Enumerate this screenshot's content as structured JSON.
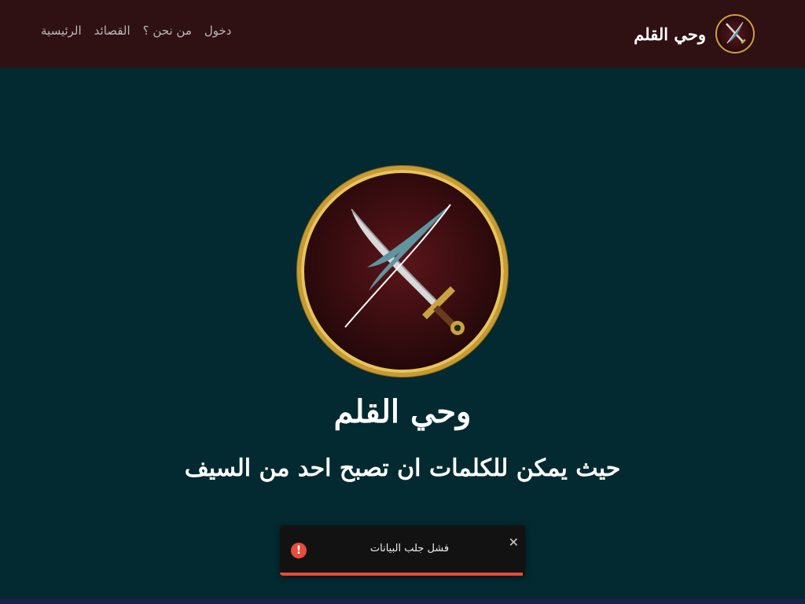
{
  "header": {
    "brand_title": "وحي القلم",
    "nav": [
      {
        "label": "الرئيسية"
      },
      {
        "label": "القصائد"
      },
      {
        "label": "من نحن ؟"
      },
      {
        "label": "دخول"
      }
    ]
  },
  "hero": {
    "title": "وحي القلم",
    "subtitle": "حيث يمكن للكلمات ان تصبح احد من السيف"
  },
  "toast": {
    "message": "فشل جلب البيانات",
    "icon": "!",
    "close_label": "✕",
    "progress": 0.99
  },
  "colors": {
    "header_bg": "#2f1013",
    "page_bg": "#022a30",
    "accent_gold": "#c9a340",
    "toast_error": "#e74c3c"
  }
}
